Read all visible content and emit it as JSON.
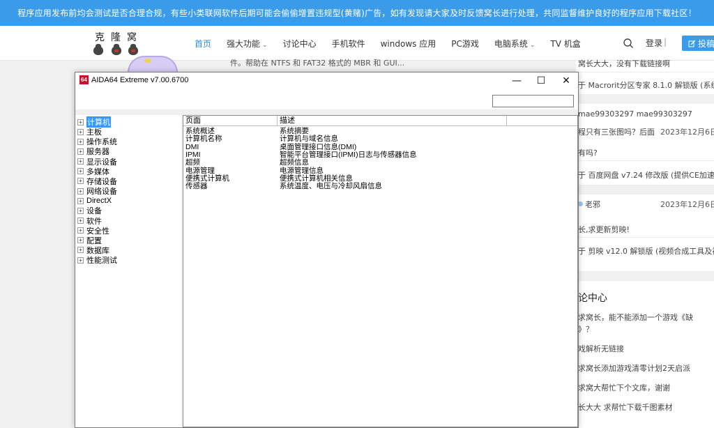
{
  "banner": {
    "text": "程序应用发布前均会测试是否合理合规，有些小类联网软件后期可能会偷偷增置违规型(黄赌)广告，如有发现请大家及时反馈窝长进行处理，共同监督维护良好的程序应用下载社区！"
  },
  "header": {
    "logo_text": "克隆窝",
    "nav": [
      {
        "label": "首页",
        "active": true,
        "dropdown": false
      },
      {
        "label": "强大功能",
        "active": false,
        "dropdown": true
      },
      {
        "label": "讨论中心",
        "active": false,
        "dropdown": false
      },
      {
        "label": "手机软件",
        "active": false,
        "dropdown": false
      },
      {
        "label": "windows 应用",
        "active": false,
        "dropdown": false
      },
      {
        "label": "PC游戏",
        "active": false,
        "dropdown": false
      },
      {
        "label": "电脑系统",
        "active": false,
        "dropdown": true
      },
      {
        "label": "TV 机盒",
        "active": false,
        "dropdown": false
      }
    ],
    "login": "登录",
    "login_sep": "|",
    "submit": "投稿",
    "accent_color": "#3a9be8"
  },
  "background_page": {
    "article_line": "件。帮助在 NTFS 和 FAT32 格式的 MBR 和 GUI...",
    "sidebar": {
      "rows": [
        {
          "text": "窝长大大，没有下载链接啊"
        },
        {
          "text": "于 Macrorit分区专家 8.1.0 解锁版 (系统..."
        },
        {
          "text": "mae99303297  mae99303297"
        },
        {
          "text": "程只有三张图吗？后面",
          "date": "2023年12月6日"
        },
        {
          "text": "有吗?"
        },
        {
          "text": "于 百度网盘 v7.24 修改版 (提供CE加速使..."
        },
        {
          "text": "老邪",
          "date": "2023年12月6日"
        },
        {
          "text": "长,求更新剪映!"
        },
        {
          "text": "于 剪映 v12.0 解锁版 (视频合成工具及视..."
        }
      ],
      "discussion_heading": "论中心",
      "discussion_items": [
        "求窝长，能不能添加一个游戏《缺",
        "》？",
        "戏解析无链接",
        "求窝长添加游戏清零计划2天启派",
        "求窝大帮忙下个文库，谢谢",
        "长大大 求帮忙下载千图素材"
      ]
    }
  },
  "aida": {
    "app_icon": "64",
    "title": "AIDA64 Extreme v7.00.6700",
    "window_buttons": {
      "minimize": "—",
      "maximize": "☐",
      "close": "✕"
    },
    "tree": [
      {
        "label": "计算机",
        "selected": true
      },
      {
        "label": "主板",
        "selected": false
      },
      {
        "label": "操作系统",
        "selected": false
      },
      {
        "label": "服务器",
        "selected": false
      },
      {
        "label": "显示设备",
        "selected": false
      },
      {
        "label": "多媒体",
        "selected": false
      },
      {
        "label": "存储设备",
        "selected": false
      },
      {
        "label": "网络设备",
        "selected": false
      },
      {
        "label": "DirectX",
        "selected": false
      },
      {
        "label": "设备",
        "selected": false
      },
      {
        "label": "软件",
        "selected": false
      },
      {
        "label": "安全性",
        "selected": false
      },
      {
        "label": "配置",
        "selected": false
      },
      {
        "label": "数据库",
        "selected": false
      },
      {
        "label": "性能测试",
        "selected": false
      }
    ],
    "expander_glyph": "+",
    "columns": [
      "页面",
      "描述"
    ],
    "rows": [
      {
        "page": "系统概述",
        "desc": "系统摘要"
      },
      {
        "page": "计算机名称",
        "desc": "计算机与域名信息"
      },
      {
        "page": "DMI",
        "desc": "桌面管理接口信息(DMI)"
      },
      {
        "page": "IPMI",
        "desc": "智能平台管理接口(IPMI)日志与传感器信息"
      },
      {
        "page": "超频",
        "desc": "超频信息"
      },
      {
        "page": "电源管理",
        "desc": "电源管理信息"
      },
      {
        "page": "便携式计算机",
        "desc": "便携式计算机相关信息"
      },
      {
        "page": "传感器",
        "desc": "系统温度、电压与冷却风扇信息"
      }
    ]
  }
}
